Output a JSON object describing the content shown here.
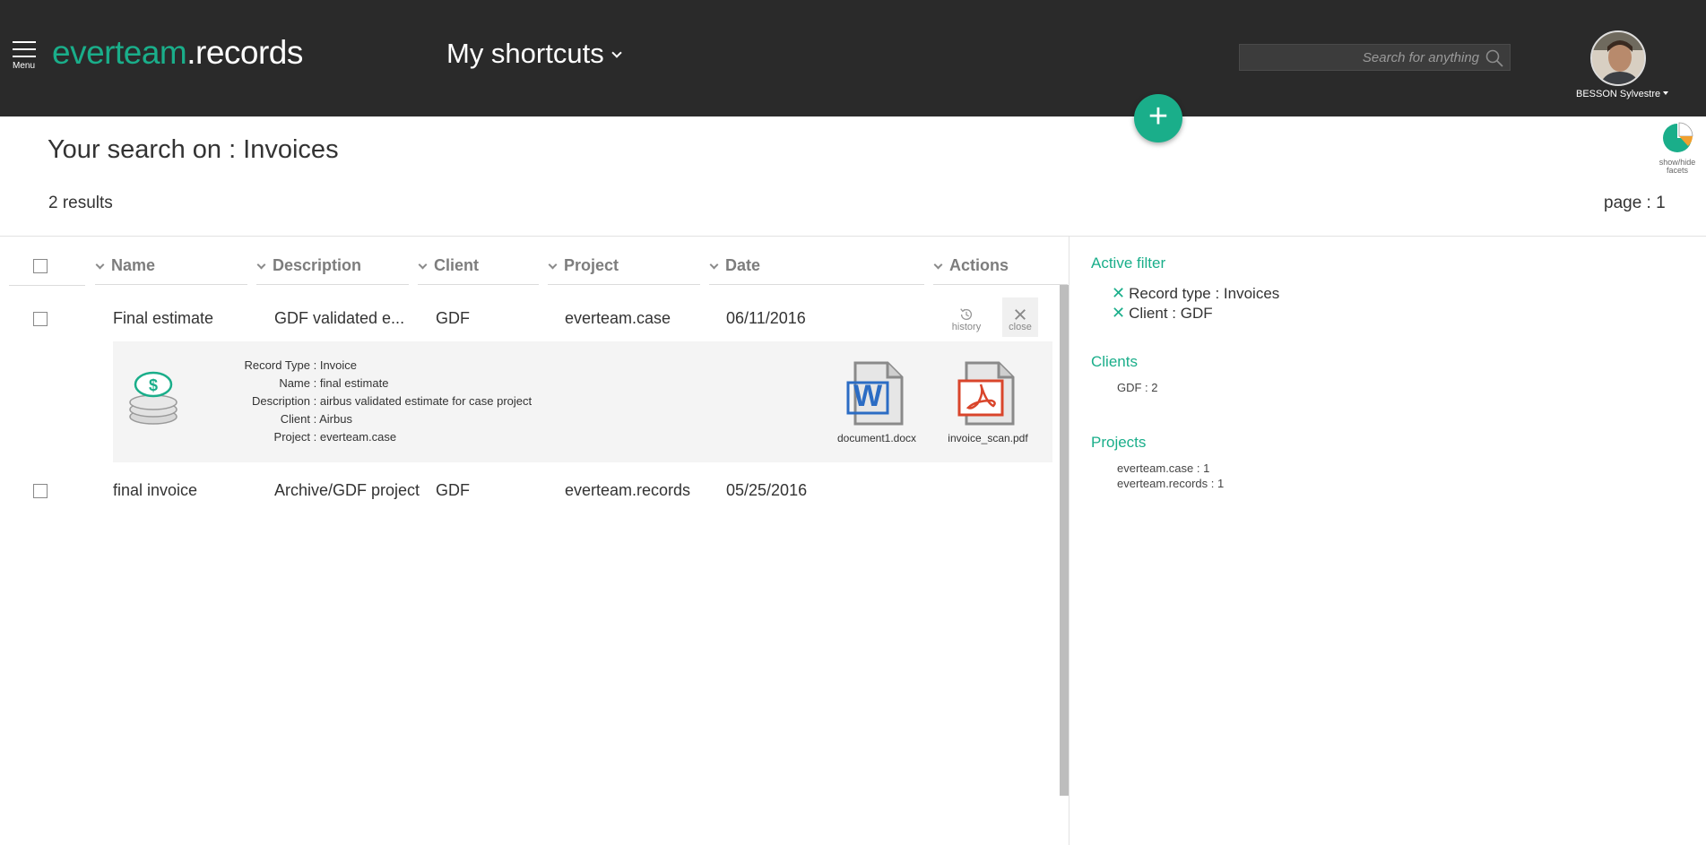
{
  "header": {
    "menu_label": "Menu",
    "brand_primary": "everteam",
    "brand_secondary": ".records",
    "shortcuts_label": "My shortcuts",
    "search_placeholder": "Search for anything",
    "user_name": "BESSON Sylvestre",
    "add_button": "+"
  },
  "page": {
    "title": "Your search on : Invoices",
    "results_count": "2 results",
    "page_indicator": "page : 1",
    "facets_toggle_line1": "show/hide",
    "facets_toggle_line2": "facets"
  },
  "table": {
    "columns": [
      "Name",
      "Description",
      "Client",
      "Project",
      "Date",
      "Actions"
    ],
    "rows": [
      {
        "name": "Final estimate",
        "description": "GDF validated e...",
        "client": "GDF",
        "project": "everteam.case",
        "date": "06/11/2016"
      },
      {
        "name": "final invoice",
        "description": "Archive/GDF project",
        "client": "GDF",
        "project": "everteam.records",
        "date": "05/25/2016"
      }
    ],
    "actions": {
      "history": "history",
      "close": "close"
    }
  },
  "detail": {
    "fields": [
      {
        "key": "Record Type",
        "value": "Invoice"
      },
      {
        "key": "Name",
        "value": "final estimate"
      },
      {
        "key": "Description",
        "value": "airbus validated estimate for case project"
      },
      {
        "key": "Client",
        "value": "Airbus"
      },
      {
        "key": "Project",
        "value": "everteam.case"
      }
    ],
    "files": [
      {
        "name": "document1.docx",
        "icon": "word-document-icon"
      },
      {
        "name": "invoice_scan.pdf",
        "icon": "pdf-document-icon"
      }
    ]
  },
  "facets": {
    "active_filter_title": "Active filter",
    "active_filters": [
      "Record type : Invoices",
      "Client : GDF"
    ],
    "clients_title": "Clients",
    "clients": [
      "GDF : 2"
    ],
    "projects_title": "Projects",
    "projects": [
      "everteam.case : 1",
      "everteam.records : 1"
    ]
  },
  "colors": {
    "accent": "#1aae8a",
    "topbar": "#2a2a2a"
  }
}
